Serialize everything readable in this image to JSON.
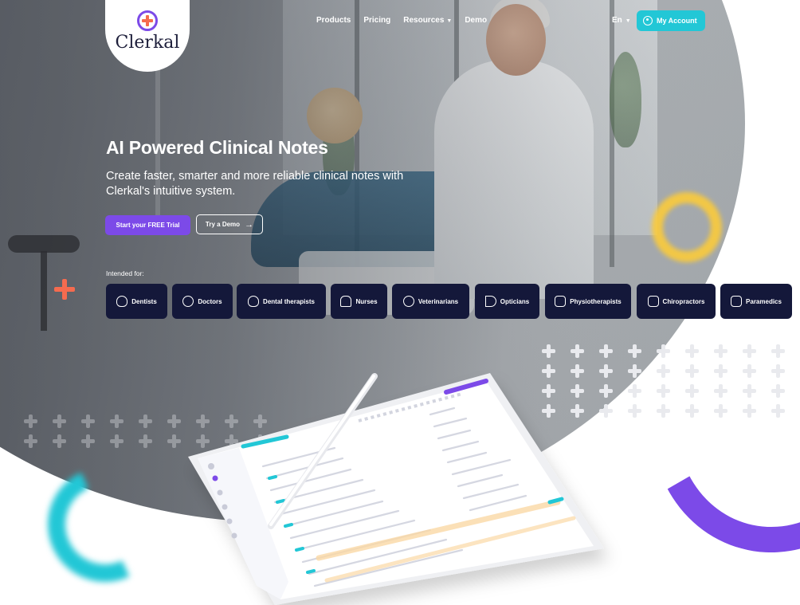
{
  "brand": {
    "name": "Clerkal",
    "accent": "#7c4ae8",
    "secondary": "#22c7d6",
    "plus_color": "#f56b4f"
  },
  "nav": {
    "items": [
      {
        "label": "Products",
        "dropdown": false
      },
      {
        "label": "Pricing",
        "dropdown": false
      },
      {
        "label": "Resources",
        "dropdown": true
      },
      {
        "label": "Demo",
        "dropdown": false
      }
    ],
    "language": "En",
    "account_label": "My Account"
  },
  "hero": {
    "title": "AI Powered Clinical Notes",
    "subtitle": "Create faster, smarter and more reliable clinical notes with Clerkal's intuitive system.",
    "cta_primary": "Start your FREE Trial",
    "cta_secondary": "Try a Demo",
    "cta_secondary_icon": "arrow-right-icon",
    "intended_label": "Intended for:"
  },
  "professions": [
    {
      "label": "Dentists",
      "icon": "tooth-icon"
    },
    {
      "label": "Doctors",
      "icon": "stethoscope-icon"
    },
    {
      "label": "Dental therapists",
      "icon": "tooth-icon"
    },
    {
      "label": "Nurses",
      "icon": "nurse-icon"
    },
    {
      "label": "Veterinarians",
      "icon": "paw-icon"
    },
    {
      "label": "Opticians",
      "icon": "eye-icon"
    },
    {
      "label": "Physiotherapists",
      "icon": "physio-icon"
    },
    {
      "label": "Chiropractors",
      "icon": "spine-icon"
    },
    {
      "label": "Paramedics",
      "icon": "camera-icon"
    }
  ]
}
